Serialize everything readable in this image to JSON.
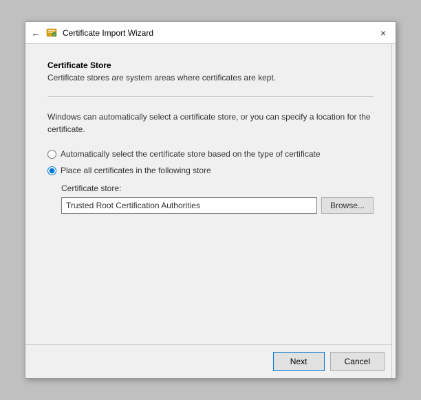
{
  "dialog": {
    "title": "Certificate Import Wizard",
    "close_label": "×",
    "back_arrow": "←"
  },
  "section": {
    "title": "Certificate Store",
    "description": "Certificate stores are system areas where certificates are kept."
  },
  "intro": {
    "text": "Windows can automatically select a certificate store, or you can specify a location for the certificate."
  },
  "radio_options": {
    "auto": {
      "label": "Automatically select the certificate store based on the type of certificate",
      "checked": false
    },
    "manual": {
      "label": "Place all certificates in the following store",
      "checked": true
    }
  },
  "store": {
    "label": "Certificate store:",
    "value": "Trusted Root Certification Authorities",
    "browse_label": "Browse..."
  },
  "buttons": {
    "next_label": "Next",
    "cancel_label": "Cancel"
  },
  "icons": {
    "wizard": "certificate-import-icon",
    "back": "back-arrow-icon",
    "close": "close-icon"
  }
}
